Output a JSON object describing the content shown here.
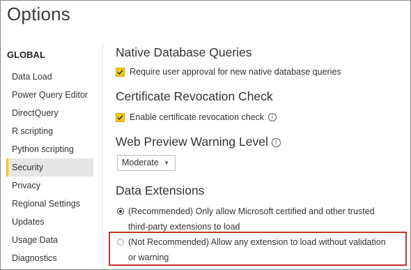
{
  "window": {
    "title": "Options"
  },
  "sidebar": {
    "header": "GLOBAL",
    "items": [
      {
        "label": "Data Load"
      },
      {
        "label": "Power Query Editor"
      },
      {
        "label": "DirectQuery"
      },
      {
        "label": "R scripting"
      },
      {
        "label": "Python scripting"
      },
      {
        "label": "Security",
        "selected": true
      },
      {
        "label": "Privacy"
      },
      {
        "label": "Regional Settings"
      },
      {
        "label": "Updates"
      },
      {
        "label": "Usage Data"
      },
      {
        "label": "Diagnostics"
      }
    ]
  },
  "main": {
    "native_db": {
      "heading": "Native Database Queries",
      "checkbox_label": "Require user approval for new native database queries",
      "checked": true
    },
    "cert_revocation": {
      "heading": "Certificate Revocation Check",
      "checkbox_label": "Enable certificate revocation check",
      "checked": true
    },
    "web_preview": {
      "heading": "Web Preview Warning Level",
      "dropdown_value": "Moderate"
    },
    "data_extensions": {
      "heading": "Data Extensions",
      "options": [
        {
          "line1": "(Recommended) Only allow Microsoft certified and other trusted",
          "line2": "third-party extensions to load",
          "selected": true
        },
        {
          "line1": "(Not Recommended) Allow any extension to load without validation",
          "line2": "or warning",
          "selected": false
        }
      ]
    }
  },
  "colors": {
    "accent_yellow": "#f2c811",
    "highlight_red": "#c0392b",
    "selected_bg": "#e6e6e6"
  },
  "icons": {
    "info": "info-circle-icon",
    "checkmark": "checkmark-icon",
    "dropdown": "chevron-down-icon"
  }
}
